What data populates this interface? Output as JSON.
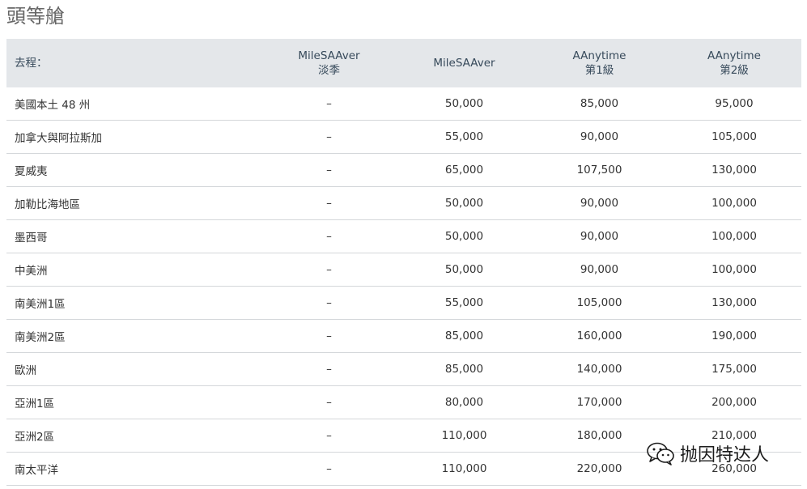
{
  "title": "頭等艙",
  "table": {
    "headers": {
      "route": "去程：",
      "col1": [
        "MileSAAver",
        "淡季"
      ],
      "col2": [
        "MileSAAver"
      ],
      "col3": [
        "AAnytime",
        "第1級"
      ],
      "col4": [
        "AAnytime",
        "第2級"
      ]
    },
    "rows": [
      {
        "route": "美國本土 48 州",
        "c1": "–",
        "c2": "50,000",
        "c3": "85,000",
        "c4": "95,000"
      },
      {
        "route": "加拿大與阿拉斯加",
        "c1": "–",
        "c2": "55,000",
        "c3": "90,000",
        "c4": "105,000"
      },
      {
        "route": "夏威夷",
        "c1": "–",
        "c2": "65,000",
        "c3": "107,500",
        "c4": "130,000"
      },
      {
        "route": "加勒比海地區",
        "c1": "–",
        "c2": "50,000",
        "c3": "90,000",
        "c4": "100,000"
      },
      {
        "route": "墨西哥",
        "c1": "–",
        "c2": "50,000",
        "c3": "90,000",
        "c4": "100,000"
      },
      {
        "route": "中美洲",
        "c1": "–",
        "c2": "50,000",
        "c3": "90,000",
        "c4": "100,000"
      },
      {
        "route": "南美洲1區",
        "c1": "–",
        "c2": "55,000",
        "c3": "105,000",
        "c4": "130,000"
      },
      {
        "route": "南美洲2區",
        "c1": "–",
        "c2": "85,000",
        "c3": "160,000",
        "c4": "190,000"
      },
      {
        "route": "歐洲",
        "c1": "–",
        "c2": "85,000",
        "c3": "140,000",
        "c4": "175,000"
      },
      {
        "route": "亞洲1區",
        "c1": "–",
        "c2": "80,000",
        "c3": "170,000",
        "c4": "200,000"
      },
      {
        "route": "亞洲2區",
        "c1": "–",
        "c2": "110,000",
        "c3": "180,000",
        "c4": "210,000"
      },
      {
        "route": "南太平洋",
        "c1": "–",
        "c2": "110,000",
        "c3": "220,000",
        "c4": "260,000"
      }
    ]
  },
  "watermark": {
    "text": "抛因特达人",
    "icon": "wechat-icon"
  }
}
